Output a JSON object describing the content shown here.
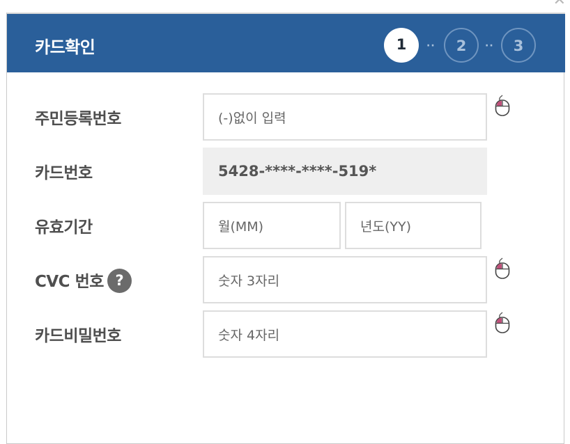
{
  "header": {
    "title": "카드확인",
    "steps": [
      "1",
      "2",
      "3"
    ],
    "separator": "··"
  },
  "form": {
    "rrn": {
      "label": "주민등록번호",
      "placeholder": "(-)없이 입력"
    },
    "card_number": {
      "label": "카드번호",
      "value": "5428-****-****-519*"
    },
    "expiry": {
      "label": "유효기간",
      "month_placeholder": "월(MM)",
      "year_placeholder": "년도(YY)"
    },
    "cvc": {
      "label": "CVC 번호",
      "help": "?",
      "placeholder": "숫자 3자리"
    },
    "password": {
      "label": "카드비밀번호",
      "placeholder": "숫자 4자리"
    }
  },
  "icons": {
    "close": "close-icon",
    "mouse": "mouse-icon",
    "help": "question-icon"
  },
  "colors": {
    "header_bg": "#2a5f9a",
    "label": "#4f4f4f",
    "mouse_button": "#c0507a"
  }
}
